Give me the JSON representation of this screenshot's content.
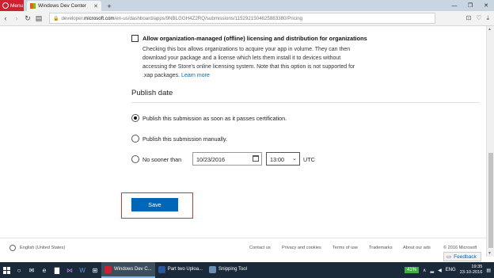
{
  "browser": {
    "menu_label": "Menu",
    "tab_title": "Windows Dev Center",
    "url_prefix": "developer.",
    "url_host": "microsoft.com",
    "url_path": "/en-us/dashboard/apps/9NBLGGH4Z2RQ/submissions/1152921504625883380/Pricing"
  },
  "licensing": {
    "checkbox_label": "Allow organization-managed (offline) licensing and distribution for organizations",
    "description": "Checking this box allows organizations to acquire your app in volume. They can then download your package and a license which lets them install it to devices without accessing the Store's online licensing system. Note that this option is not supported for .xap packages.",
    "learn_more": "Learn more"
  },
  "publish": {
    "title": "Publish date",
    "option_asap": "Publish this submission as soon as it passes certification.",
    "option_manual": "Publish this submission manually.",
    "option_no_sooner": "No sooner than",
    "date_value": "10/23/2016",
    "time_value": "13:00",
    "timezone": "UTC",
    "selected": "asap"
  },
  "actions": {
    "save_label": "Save"
  },
  "footer": {
    "language": "English (United States)",
    "links": [
      "Contact us",
      "Privacy and cookies",
      "Terms of use",
      "Trademarks",
      "About our ads"
    ],
    "copyright": "© 2016 Microsoft",
    "feedback": "Feedback"
  },
  "taskbar": {
    "apps": [
      {
        "label": "Windows Dev C...",
        "active": true
      },
      {
        "label": "Part  two Uploa...",
        "active": false
      },
      {
        "label": "Snipping Tool",
        "active": false
      }
    ],
    "battery": "41%",
    "language": "ENG",
    "time": "19:35",
    "date": "23-10-2016"
  },
  "colors": {
    "accent": "#0067b8",
    "highlight_outline": "#e03030",
    "taskbar": "#1b2a3a"
  }
}
